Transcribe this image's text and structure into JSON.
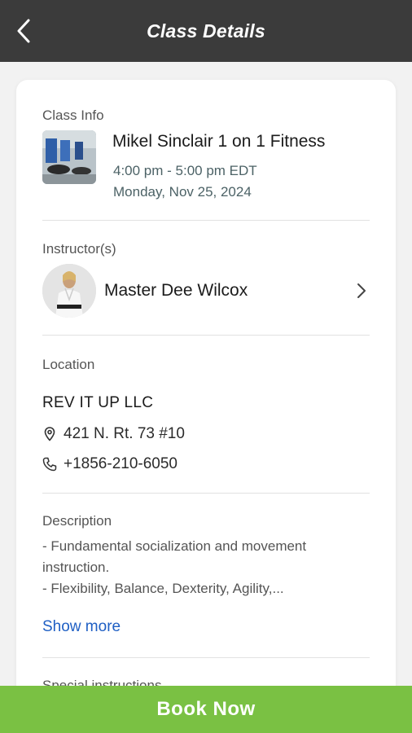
{
  "header": {
    "title": "Class Details",
    "back_icon": "chevron-left-icon"
  },
  "class_info": {
    "section_label": "Class Info",
    "name": "Mikel Sinclair 1 on 1 Fitness",
    "time": "4:00 pm - 5:00 pm EDT",
    "date": "Monday, Nov 25, 2024"
  },
  "instructors": {
    "section_label": "Instructor(s)",
    "items": [
      {
        "name": "Master Dee Wilcox"
      }
    ]
  },
  "location": {
    "section_label": "Location",
    "name": "REV IT UP LLC",
    "address": "421 N. Rt. 73 #10",
    "phone": "+1856-210-6050"
  },
  "description": {
    "section_label": "Description",
    "line1": "- Fundamental socialization and movement instruction.",
    "line2": "- Flexibility, Balance, Dexterity, Agility,...",
    "show_more": "Show more"
  },
  "special_instructions": {
    "section_label": "Special instructions"
  },
  "footer": {
    "book_label": "Book Now"
  },
  "colors": {
    "header_bg": "#3b3b3b",
    "book_button_bg": "#7ac143",
    "link": "#1f5fc4",
    "time_text": "#4c6266"
  }
}
